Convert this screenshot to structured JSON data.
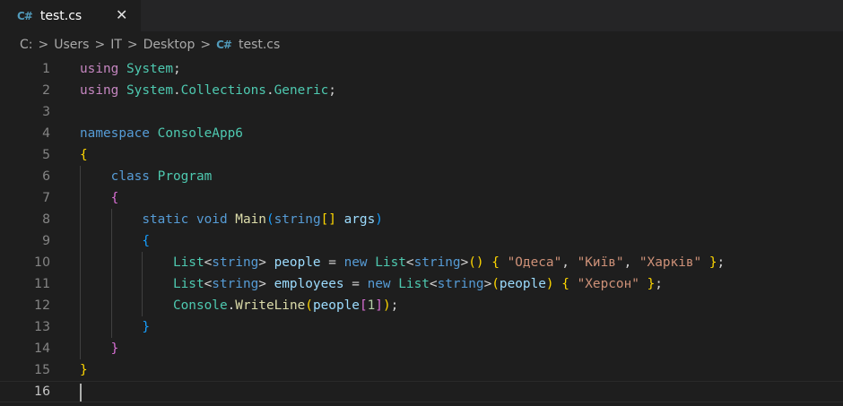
{
  "tab": {
    "label": "test.cs",
    "icon": "csharp-file-icon",
    "icon_glyph": "C#"
  },
  "breadcrumb": {
    "segments": [
      "C:",
      "Users",
      "IT",
      "Desktop"
    ],
    "file": "test.cs",
    "separator": ">"
  },
  "editor": {
    "line_numbers": [
      "1",
      "2",
      "3",
      "4",
      "5",
      "6",
      "7",
      "8",
      "9",
      "10",
      "11",
      "12",
      "13",
      "14",
      "15",
      "16"
    ],
    "lines": [
      [
        [
          "kc",
          "using"
        ],
        [
          "pl",
          " "
        ],
        [
          "ty",
          "System"
        ],
        [
          "pl",
          ";"
        ]
      ],
      [
        [
          "kc",
          "using"
        ],
        [
          "pl",
          " "
        ],
        [
          "ty",
          "System"
        ],
        [
          "pl",
          "."
        ],
        [
          "ty",
          "Collections"
        ],
        [
          "pl",
          "."
        ],
        [
          "ty",
          "Generic"
        ],
        [
          "pl",
          ";"
        ]
      ],
      [],
      [
        [
          "kw",
          "namespace"
        ],
        [
          "pl",
          " "
        ],
        [
          "ty",
          "ConsoleApp6"
        ]
      ],
      [
        [
          "b1",
          "{"
        ]
      ],
      [
        [
          "pl",
          "    "
        ],
        [
          "kw",
          "class"
        ],
        [
          "pl",
          " "
        ],
        [
          "ty",
          "Program"
        ]
      ],
      [
        [
          "pl",
          "    "
        ],
        [
          "b2",
          "{"
        ]
      ],
      [
        [
          "pl",
          "        "
        ],
        [
          "kw",
          "static"
        ],
        [
          "pl",
          " "
        ],
        [
          "kw",
          "void"
        ],
        [
          "pl",
          " "
        ],
        [
          "fn",
          "Main"
        ],
        [
          "b3",
          "("
        ],
        [
          "kw",
          "string"
        ],
        [
          "b1",
          "[]"
        ],
        [
          "pl",
          " "
        ],
        [
          "vr",
          "args"
        ],
        [
          "b3",
          ")"
        ]
      ],
      [
        [
          "pl",
          "        "
        ],
        [
          "b3",
          "{"
        ]
      ],
      [
        [
          "pl",
          "            "
        ],
        [
          "ty",
          "List"
        ],
        [
          "pl",
          "<"
        ],
        [
          "kw",
          "string"
        ],
        [
          "pl",
          "> "
        ],
        [
          "vr",
          "people"
        ],
        [
          "pl",
          " = "
        ],
        [
          "kw",
          "new"
        ],
        [
          "pl",
          " "
        ],
        [
          "ty",
          "List"
        ],
        [
          "pl",
          "<"
        ],
        [
          "kw",
          "string"
        ],
        [
          "pl",
          ">"
        ],
        [
          "b1",
          "()"
        ],
        [
          "pl",
          " "
        ],
        [
          "b1",
          "{"
        ],
        [
          "pl",
          " "
        ],
        [
          "st",
          "\"Одеса\""
        ],
        [
          "pl",
          ", "
        ],
        [
          "st",
          "\"Київ\""
        ],
        [
          "pl",
          ", "
        ],
        [
          "st",
          "\"Харків\""
        ],
        [
          "pl",
          " "
        ],
        [
          "b1",
          "}"
        ],
        [
          "pl",
          ";"
        ]
      ],
      [
        [
          "pl",
          "            "
        ],
        [
          "ty",
          "List"
        ],
        [
          "pl",
          "<"
        ],
        [
          "kw",
          "string"
        ],
        [
          "pl",
          "> "
        ],
        [
          "vr",
          "employees"
        ],
        [
          "pl",
          " = "
        ],
        [
          "kw",
          "new"
        ],
        [
          "pl",
          " "
        ],
        [
          "ty",
          "List"
        ],
        [
          "pl",
          "<"
        ],
        [
          "kw",
          "string"
        ],
        [
          "pl",
          ">"
        ],
        [
          "b1",
          "("
        ],
        [
          "vr",
          "people"
        ],
        [
          "b1",
          ")"
        ],
        [
          "pl",
          " "
        ],
        [
          "b1",
          "{"
        ],
        [
          "pl",
          " "
        ],
        [
          "st",
          "\"Херсон\""
        ],
        [
          "pl",
          " "
        ],
        [
          "b1",
          "}"
        ],
        [
          "pl",
          ";"
        ]
      ],
      [
        [
          "pl",
          "            "
        ],
        [
          "ty",
          "Console"
        ],
        [
          "pl",
          "."
        ],
        [
          "fn",
          "WriteLine"
        ],
        [
          "b1",
          "("
        ],
        [
          "vr",
          "people"
        ],
        [
          "b2",
          "["
        ],
        [
          "nu",
          "1"
        ],
        [
          "b2",
          "]"
        ],
        [
          "b1",
          ")"
        ],
        [
          "pl",
          ";"
        ]
      ],
      [
        [
          "pl",
          "        "
        ],
        [
          "b3",
          "}"
        ]
      ],
      [
        [
          "pl",
          "    "
        ],
        [
          "b2",
          "}"
        ]
      ],
      [
        [
          "b1",
          "}"
        ]
      ],
      []
    ],
    "current_line": 16
  }
}
